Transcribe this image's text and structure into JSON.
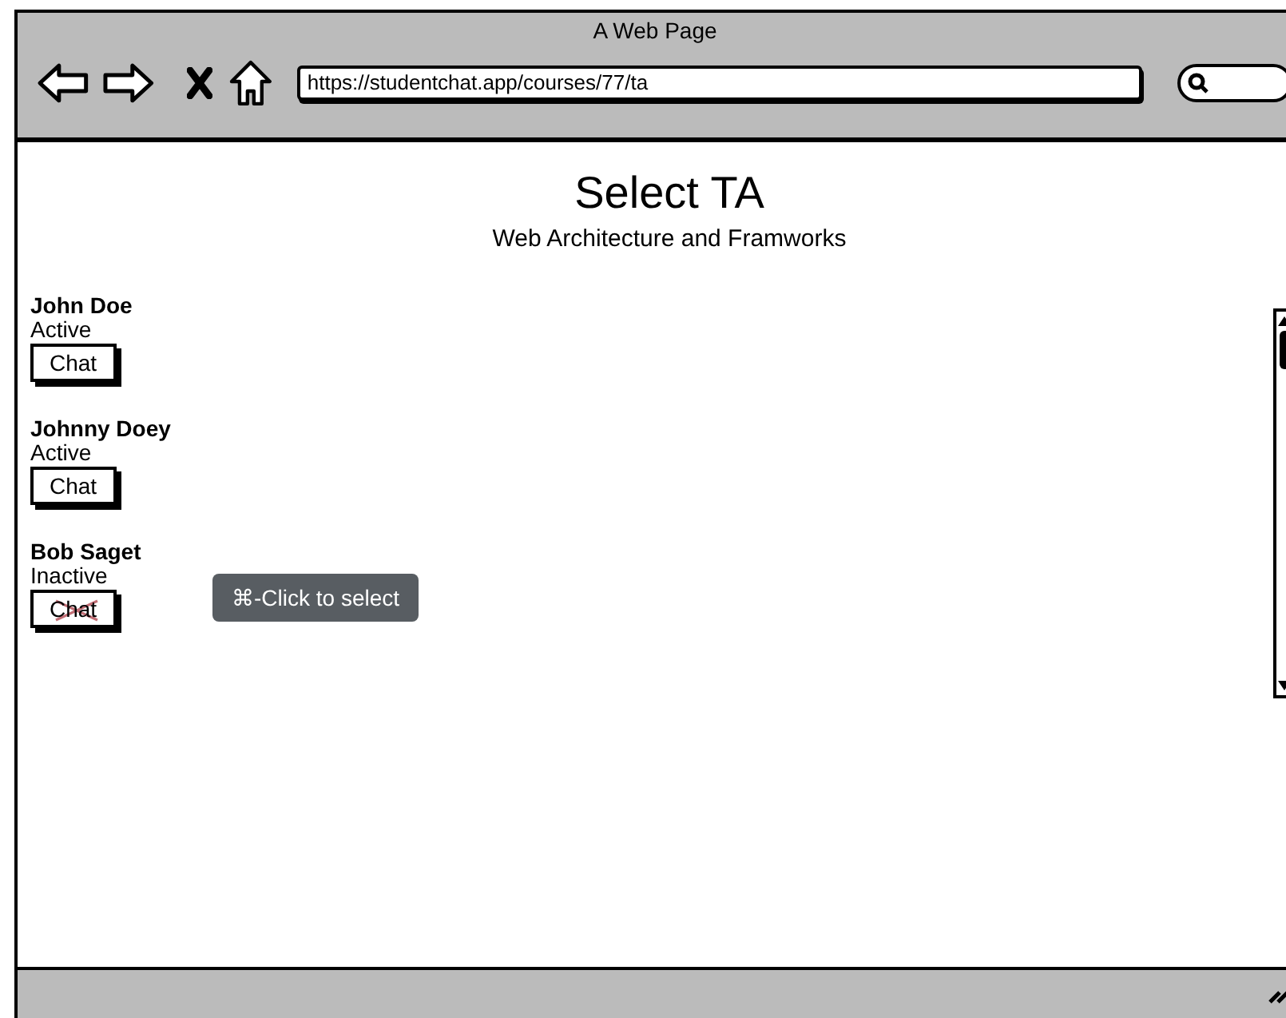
{
  "window": {
    "title": "A Web Page"
  },
  "address_bar": {
    "value": "https://studentchat.app/courses/77/ta"
  },
  "page": {
    "heading": "Select TA",
    "subheading": "Web Architecture and Framworks"
  },
  "teaching_assistants": [
    {
      "name": "John Doe",
      "status": "Active",
      "button": "Chat",
      "disabled": false
    },
    {
      "name": "Johnny Doey",
      "status": "Active",
      "button": "Chat",
      "disabled": false
    },
    {
      "name": "Bob Saget",
      "status": "Inactive",
      "button": "Chat",
      "disabled": true
    }
  ],
  "tooltip": {
    "text": "⌘-Click to select"
  }
}
